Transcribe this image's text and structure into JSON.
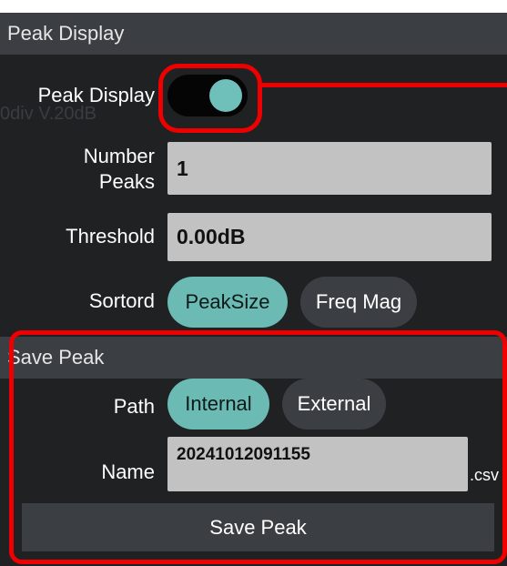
{
  "peak_display": {
    "header": "Peak Display",
    "toggle_label": "Peak Display",
    "toggle_on": true,
    "ghost_text": "0div    V.20dB",
    "number_peaks_label": "Number\nPeaks",
    "number_peaks_value": "1",
    "threshold_label": "Threshold",
    "threshold_value": "0.00dB",
    "sortord_label": "Sortord",
    "sortord_options": [
      "PeakSize",
      "Freq Mag"
    ],
    "sortord_selected": "PeakSize"
  },
  "save_peak": {
    "header": "Save Peak",
    "path_label": "Path",
    "path_options": [
      "Internal",
      "External"
    ],
    "path_selected": "Internal",
    "name_label": "Name",
    "name_value": "20241012091155",
    "name_suffix": ".csv",
    "save_button": "Save Peak"
  },
  "colors": {
    "panel_bg": "#1f2123",
    "header_bg": "#3b3f43",
    "accent": "#6bbbb4",
    "field_bg": "#c2c2c2",
    "highlight": "#ee0000"
  }
}
